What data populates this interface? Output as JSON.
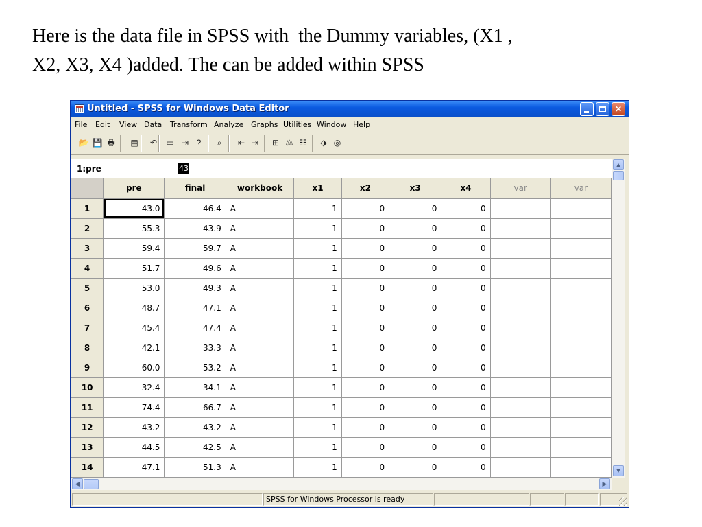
{
  "slide": {
    "line1": "Here is the data file in SPSS with  the Dummy variables, (X1 ,",
    "line2": "X2, X3, X4 )added. The can be added within SPSS"
  },
  "window": {
    "title": "Untitled - SPSS for Windows Data Editor",
    "titlebar_color": "#0b5ae0"
  },
  "menu": [
    "File",
    "Edit",
    "View",
    "Data",
    "Transform",
    "Analyze",
    "Graphs",
    "Utilities",
    "Window",
    "Help"
  ],
  "toolbar": [
    "open-icon",
    "save-icon",
    "print-icon",
    "dialog-recall-icon",
    "undo-icon",
    "goto-chart-icon",
    "goto-case-icon",
    "variables-icon",
    "find-icon",
    "insert-case-icon",
    "insert-variable-icon",
    "split-file-icon",
    "weight-cases-icon",
    "select-cases-icon",
    "value-labels-icon",
    "use-sets-icon"
  ],
  "cell_editor": {
    "ref": "1:pre",
    "value": "43"
  },
  "grid": {
    "columns": [
      "pre",
      "final",
      "workbook",
      "x1",
      "x2",
      "x3",
      "x4",
      "var",
      "var"
    ],
    "rows": [
      [
        "1",
        "43.0",
        "46.4",
        "A",
        "1",
        "0",
        "0",
        "0"
      ],
      [
        "2",
        "55.3",
        "43.9",
        "A",
        "1",
        "0",
        "0",
        "0"
      ],
      [
        "3",
        "59.4",
        "59.7",
        "A",
        "1",
        "0",
        "0",
        "0"
      ],
      [
        "4",
        "51.7",
        "49.6",
        "A",
        "1",
        "0",
        "0",
        "0"
      ],
      [
        "5",
        "53.0",
        "49.3",
        "A",
        "1",
        "0",
        "0",
        "0"
      ],
      [
        "6",
        "48.7",
        "47.1",
        "A",
        "1",
        "0",
        "0",
        "0"
      ],
      [
        "7",
        "45.4",
        "47.4",
        "A",
        "1",
        "0",
        "0",
        "0"
      ],
      [
        "8",
        "42.1",
        "33.3",
        "A",
        "1",
        "0",
        "0",
        "0"
      ],
      [
        "9",
        "60.0",
        "53.2",
        "A",
        "1",
        "0",
        "0",
        "0"
      ],
      [
        "10",
        "32.4",
        "34.1",
        "A",
        "1",
        "0",
        "0",
        "0"
      ],
      [
        "11",
        "74.4",
        "66.7",
        "A",
        "1",
        "0",
        "0",
        "0"
      ],
      [
        "12",
        "43.2",
        "43.2",
        "A",
        "1",
        "0",
        "0",
        "0"
      ],
      [
        "13",
        "44.5",
        "42.5",
        "A",
        "1",
        "0",
        "0",
        "0"
      ],
      [
        "14",
        "47.1",
        "51.3",
        "A",
        "1",
        "0",
        "0",
        "0"
      ]
    ]
  },
  "status": {
    "message": "SPSS for Windows Processor is ready"
  }
}
